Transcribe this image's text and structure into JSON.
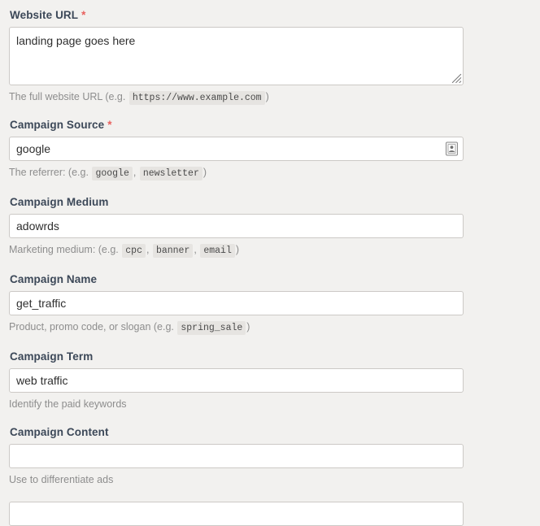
{
  "form": {
    "background_color": "#f2f1ef",
    "label_color": "#3c4858",
    "required_marker_color": "#e8615e",
    "help_text_color": "#8d8d8d",
    "input_border_color": "#ccc9c6",
    "code_chip_background": "#e6e4e1",
    "required_marker": "*",
    "fields": [
      {
        "key": "website_url",
        "label": "Website URL",
        "required": true,
        "control": "textarea",
        "value": "landing page goes here",
        "placeholder": "",
        "help_prefix": "The full website URL (e.g.",
        "help_chips": [
          "https://www.example.com"
        ],
        "help_suffix": ")",
        "has_resize_handle": true
      },
      {
        "key": "campaign_source",
        "label": "Campaign Source",
        "required": true,
        "control": "input",
        "value": "google",
        "placeholder": "",
        "help_prefix": "The referrer: (e.g.",
        "help_chips": [
          "google",
          "newsletter"
        ],
        "help_suffix": ")",
        "icon": "autofill-card-icon"
      },
      {
        "key": "campaign_medium",
        "label": "Campaign Medium",
        "required": false,
        "control": "input",
        "value": "adowrds",
        "placeholder": "",
        "help_prefix": "Marketing medium: (e.g.",
        "help_chips": [
          "cpc",
          "banner",
          "email"
        ],
        "help_suffix": ")"
      },
      {
        "key": "campaign_name",
        "label": "Campaign Name",
        "required": false,
        "control": "input",
        "value": "get_traffic",
        "placeholder": "",
        "help_prefix": "Product, promo code, or slogan (e.g.",
        "help_chips": [
          "spring_sale"
        ],
        "help_suffix": ")"
      },
      {
        "key": "campaign_term",
        "label": "Campaign Term",
        "required": false,
        "control": "input",
        "value": "web traffic",
        "placeholder": "",
        "help_prefix": "Identify the paid keywords",
        "help_chips": [],
        "help_suffix": ""
      },
      {
        "key": "campaign_content",
        "label": "Campaign Content",
        "required": false,
        "control": "input",
        "value": "",
        "placeholder": "",
        "help_prefix": "Use to differentiate ads",
        "help_chips": [],
        "help_suffix": ""
      }
    ]
  }
}
